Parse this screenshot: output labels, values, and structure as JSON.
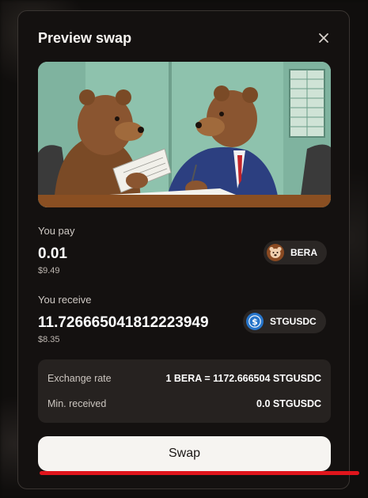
{
  "modal": {
    "title": "Preview swap"
  },
  "pay": {
    "label": "You pay",
    "amount": "0.01",
    "usd_value": "$9.49",
    "token_symbol": "BERA",
    "token_icon": "bear-icon"
  },
  "receive": {
    "label": "You receive",
    "amount": "11.726665041812223949",
    "usd_value": "$8.35",
    "token_symbol": "STGUSDC",
    "token_icon": "usdc-icon"
  },
  "details": {
    "rows": [
      {
        "label": "Exchange rate",
        "value": "1 BERA = 1172.666504 STGUSDC"
      },
      {
        "label": "Min. received",
        "value": "0.0 STGUSDC"
      }
    ]
  },
  "actions": {
    "swap_label": "Swap"
  },
  "colors": {
    "background": "#141110",
    "panel": "#262220",
    "button": "#f6f4f1",
    "annotation_red": "#e0151c",
    "usdc_blue": "#2775ca"
  }
}
